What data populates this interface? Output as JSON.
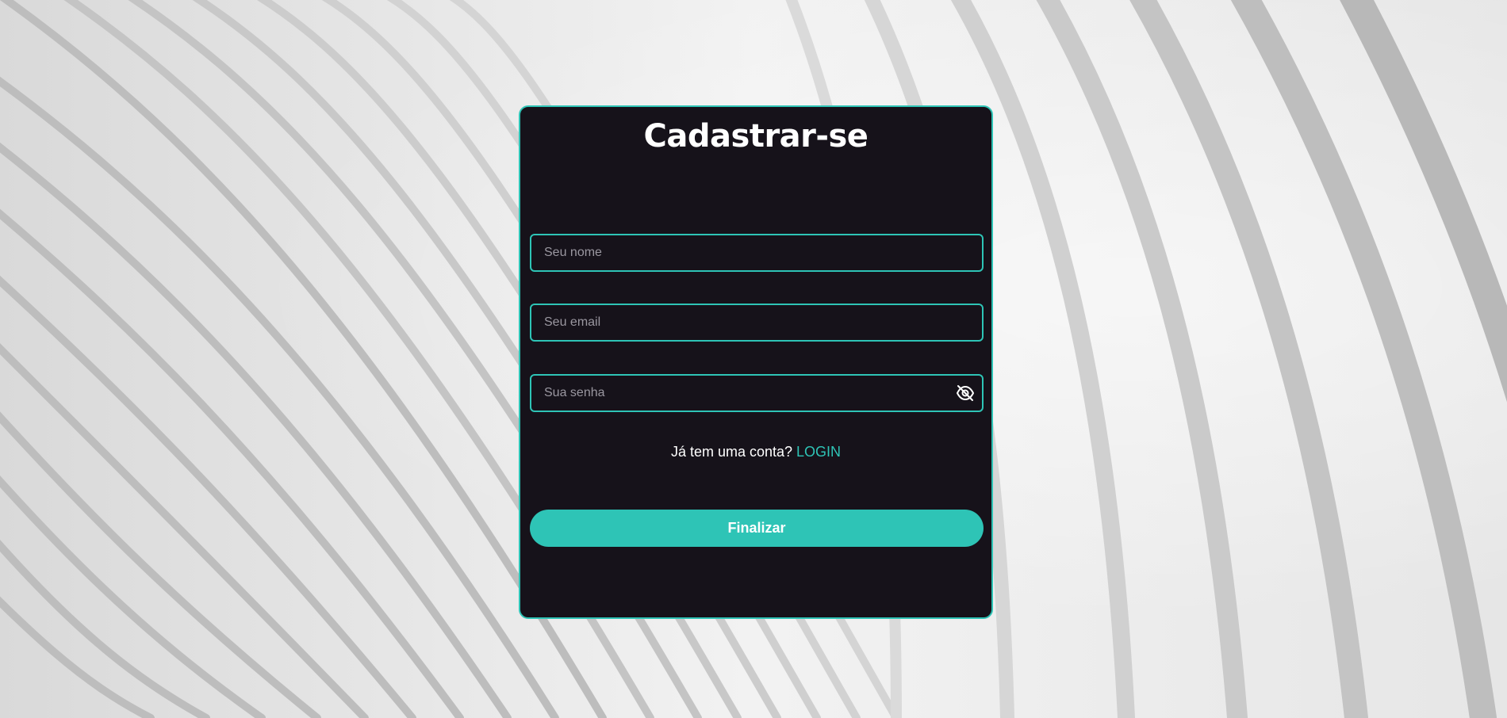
{
  "form": {
    "title": "Cadastrar-se",
    "name_placeholder": "Seu nome",
    "email_placeholder": "Seu email",
    "password_placeholder": "Sua senha",
    "password_toggle_icon": "eye-slash-icon",
    "login_prompt": "Já tem uma conta?",
    "login_link": "LOGIN",
    "submit_label": "Finalizar"
  },
  "colors": {
    "accent": "#2ec4b6",
    "card_background": "#16121a",
    "text": "#ffffff",
    "placeholder": "#9a97a0"
  }
}
